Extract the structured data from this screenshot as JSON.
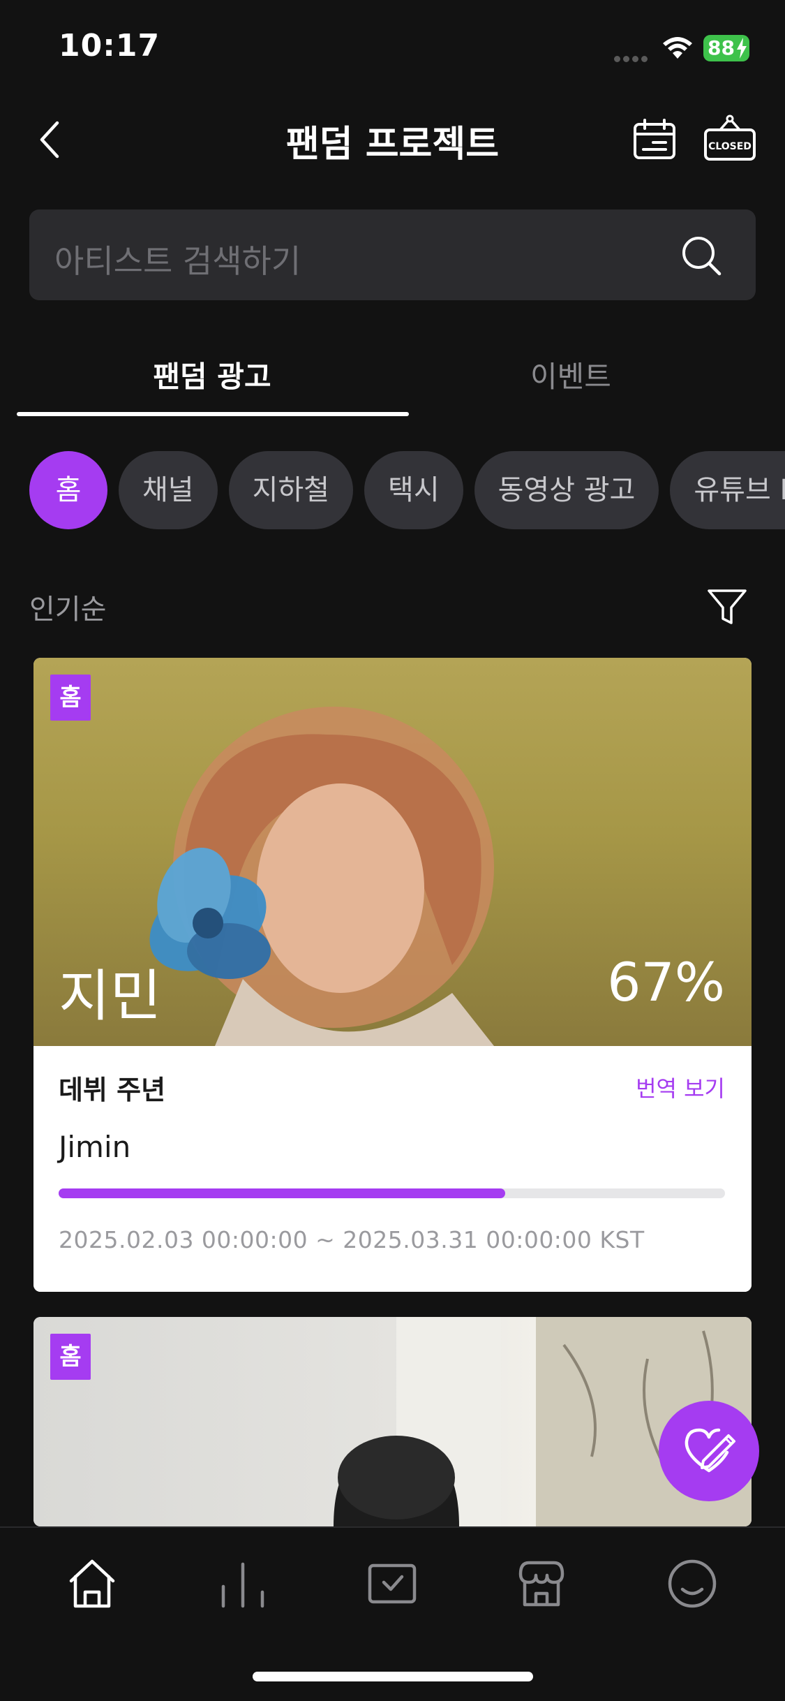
{
  "status_bar": {
    "time": "10:17",
    "battery": "88"
  },
  "header": {
    "title": "팬덤 프로젝트",
    "closed_badge": "CLOSED"
  },
  "search": {
    "placeholder": "아티스트 검색하기"
  },
  "tabs": [
    {
      "label": "팬덤 광고",
      "active": true
    },
    {
      "label": "이벤트",
      "active": false
    }
  ],
  "chips": [
    "홈",
    "채널",
    "지하철",
    "택시",
    "동영상 광고",
    "유튜브 M"
  ],
  "sort": {
    "label": "인기순"
  },
  "cards": [
    {
      "tag": "홈",
      "artist": "지민",
      "percent": "67%",
      "progress": 0.67,
      "title": "데뷔 주년",
      "translate": "번역 보기",
      "subtitle": "Jimin",
      "dates": "2025.02.03 00:00:00 ~ 2025.03.31 00:00:00 KST"
    },
    {
      "tag": "홈"
    }
  ],
  "colors": {
    "accent": "#a53cf1",
    "background": "#121212",
    "battery": "#3ec24b"
  },
  "tabbar": [
    "home-icon",
    "chart-icon",
    "vote-box-icon",
    "store-icon",
    "smile-icon"
  ]
}
